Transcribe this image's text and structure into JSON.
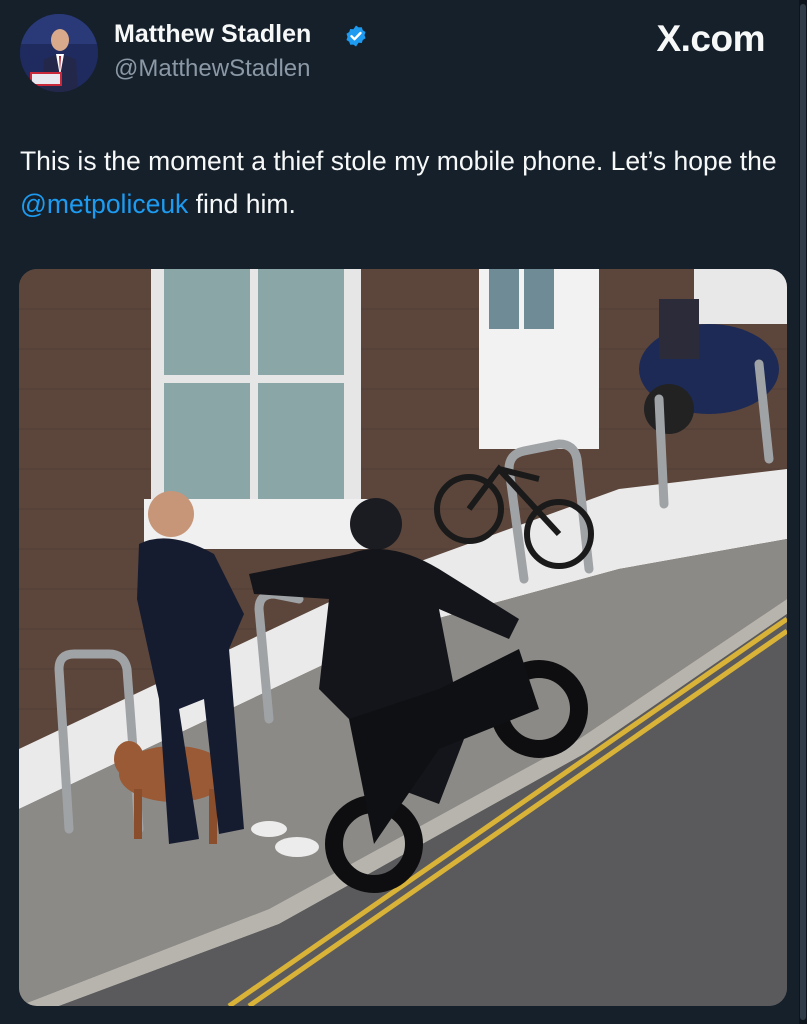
{
  "author": {
    "name": "Matthew Stadlen",
    "handle": "@MatthewStadlen",
    "verified": true,
    "verified_color": "#1d9bf0"
  },
  "brand": {
    "label": "X.com"
  },
  "tweet": {
    "text_before": "This is the moment a thief stole my mobile phone. Let’s hope the ",
    "mention": "@metpoliceuk",
    "text_after": " find him.",
    "mention_color": "#1d9bf0"
  },
  "media": {
    "kind": "photo",
    "description_icon": "street-scene-photo"
  },
  "colors": {
    "background": "#15202b",
    "text": "#f7f9f9",
    "secondary_text": "#8b98a5"
  }
}
